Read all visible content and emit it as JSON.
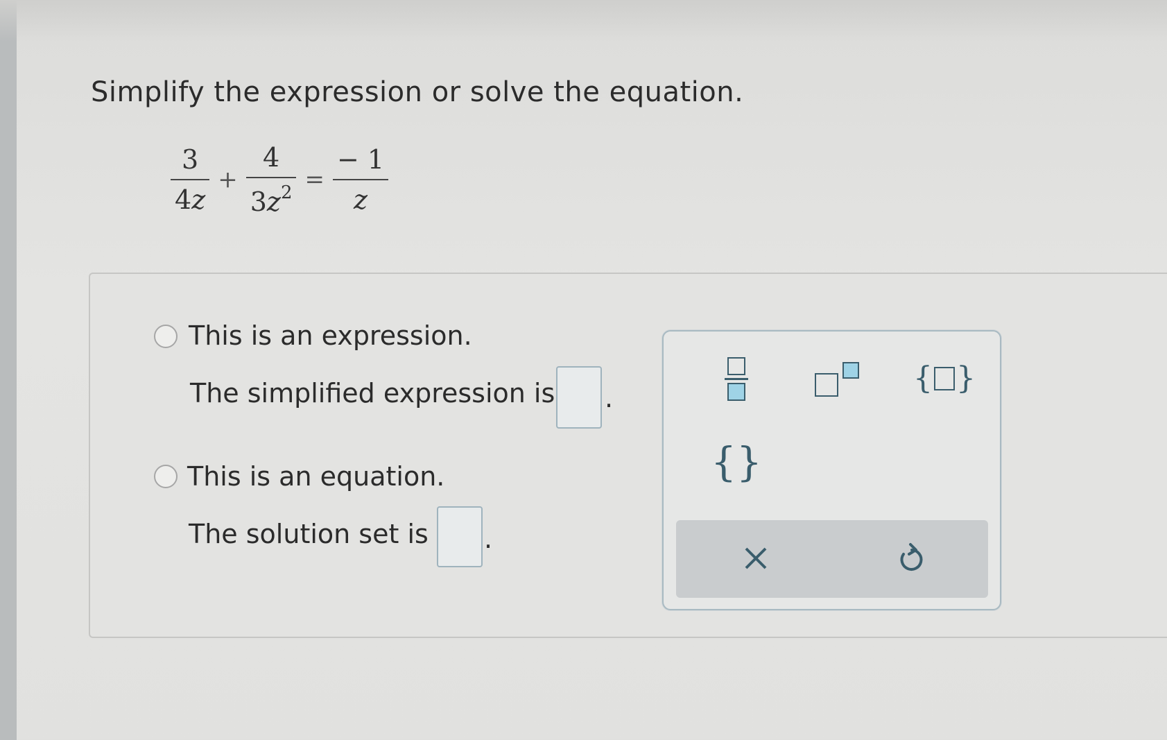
{
  "question": {
    "instruction": "Simplify the expression or solve the equation.",
    "equation": {
      "term1": {
        "numerator": "3",
        "denominator_coef": "4",
        "denominator_var": "z"
      },
      "plus": "+",
      "term2": {
        "numerator": "4",
        "denominator_coef": "3",
        "denominator_var": "z",
        "denominator_exp": "2"
      },
      "equals": "=",
      "rhs": {
        "numerator": "− 1",
        "denominator_var": "z"
      }
    }
  },
  "options": [
    {
      "label": "This is an expression.",
      "prompt": "The simplified expression is",
      "value": "",
      "suffix": "."
    },
    {
      "label": "This is an equation.",
      "prompt": "The solution set is",
      "value": "",
      "suffix": "."
    }
  ],
  "palette": {
    "buttons": [
      "fraction-template",
      "exponent-template",
      "set-with-element-template",
      "empty-set-template"
    ],
    "empty_set_text": "{}",
    "actions": {
      "clear": "×",
      "undo": "↺"
    }
  },
  "colors": {
    "accent": "#3a5d6c",
    "box_fill": "#9fd3e6"
  }
}
